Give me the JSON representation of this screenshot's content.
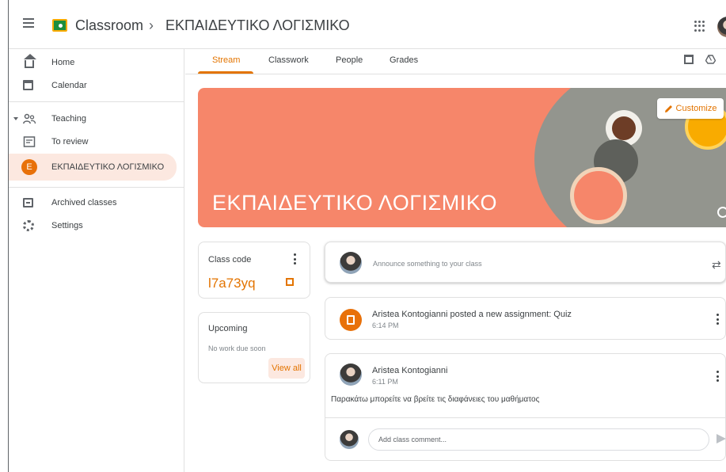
{
  "header": {
    "app_name": "Classroom",
    "separator": "›",
    "class_name": "ΕΚΠΑΙΔΕΥΤΙΚΟ ΛΟΓΙΣΜΙΚΟ",
    "icons": [
      "menu-icon",
      "classroom-logo-icon",
      "apps-grid-icon",
      "account-avatar"
    ]
  },
  "sidebar": {
    "items": [
      {
        "label": "Home",
        "icon": "home-icon"
      },
      {
        "label": "Calendar",
        "icon": "calendar-icon"
      },
      {
        "label": "Teaching",
        "icon": "people-icon"
      },
      {
        "label": "To review",
        "icon": "inbox-icon"
      },
      {
        "label": "ΕΚΠΑΙΔΕΥΤΙΚΟ ΛΟΓΙΣΜΙΚΟ",
        "icon": "class-avatar",
        "badge": "E"
      },
      {
        "label": "Archived classes",
        "icon": "archive-icon"
      },
      {
        "label": "Settings",
        "icon": "settings-icon"
      }
    ]
  },
  "tabs": [
    {
      "label": "Stream"
    },
    {
      "label": "Classwork"
    },
    {
      "label": "People"
    },
    {
      "label": "Grades"
    }
  ],
  "banner": {
    "title": "ΕΚΠΑΙΔΕΥΤΙΚΟ ΛΟΓΙΣΜΙΚΟ",
    "customize_label": "Customize",
    "color": "#f6866a"
  },
  "class_code": {
    "label": "Class code",
    "value": "l7a73yq"
  },
  "upcoming": {
    "label": "Upcoming",
    "empty_text": "No work due soon",
    "view_all_label": "View all"
  },
  "announce": {
    "placeholder": "Announce something to your class"
  },
  "posts": [
    {
      "title": "Aristea Kontogianni posted a new assignment: Quiz",
      "time": "6:14 PM"
    },
    {
      "author": "Aristea Kontogianni",
      "time": "6:11 PM",
      "body": "Παρακάτω μπορείτε να βρείτε τις διαφάνειες του μαθήματος",
      "comment_placeholder": "Add class comment..."
    }
  ],
  "colors": {
    "accent": "#e37400",
    "active_bg": "#fce8e0",
    "class_avatar": "#e8710a"
  }
}
